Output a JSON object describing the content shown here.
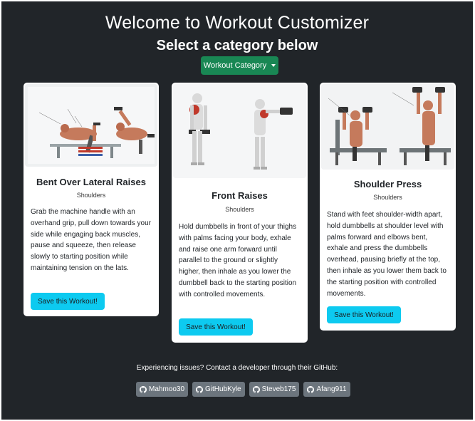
{
  "header": {
    "title": "Welcome to Workout Customizer",
    "subtitle": "Select a category below",
    "category_button": "Workout Category"
  },
  "cards": [
    {
      "title": "Bent Over Lateral Raises",
      "category": "Shoulders",
      "description": "Grab the machine handle with an overhand grip, pull down towards your side while engaging back muscles, pause and squeeze, then release slowly to starting position while maintaining tension on the lats.",
      "button": "Save this Workout!"
    },
    {
      "title": "Front Raises",
      "category": "Shoulders",
      "description": "Hold dumbbells in front of your thighs with palms facing your body, exhale and raise one arm forward until parallel to the ground or slightly higher, then inhale as you lower the dumbbell back to the starting position with controlled movements.",
      "button": "Save this Workout!"
    },
    {
      "title": "Shoulder Press",
      "category": "Shoulders",
      "description": "Stand with feet shoulder-width apart, hold dumbbells at shoulder level with palms forward and elbows bent, exhale and press the dumbbells overhead, pausing briefly at the top, then inhale as you lower them back to the starting position with controlled movements.",
      "button": "Save this Workout!"
    }
  ],
  "footer": {
    "issues_text": "Experiencing issues? Contact a developer through their GitHub:",
    "developers": [
      "Mahmoo30",
      "GitHubKyle",
      "Steveb175",
      "Afang911"
    ]
  },
  "colors": {
    "background": "#212529",
    "category_button": "#198754",
    "save_button": "#0dcaf0",
    "github_button": "#6c757d"
  },
  "icons": {
    "dropdown": "caret-down-icon",
    "github": "github-icon"
  }
}
